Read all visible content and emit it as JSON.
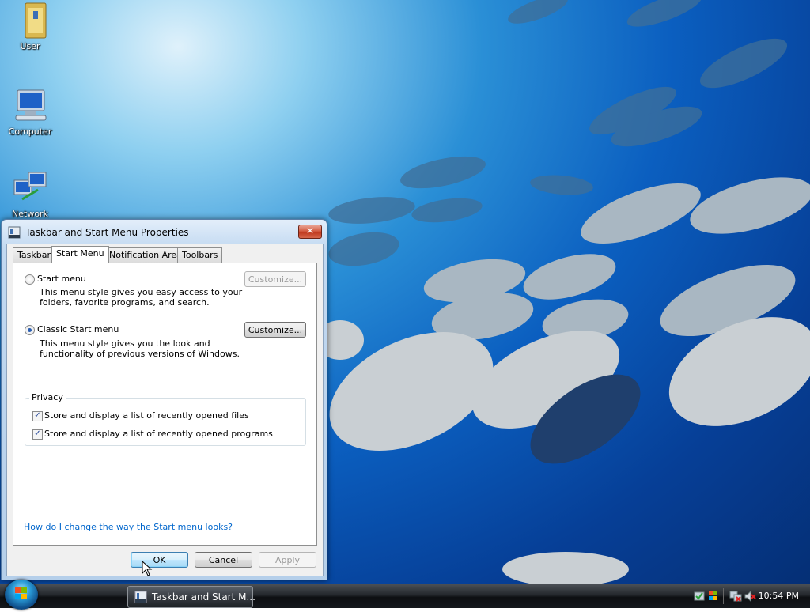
{
  "desktop": {
    "icons": [
      {
        "label": "User"
      },
      {
        "label": "Computer"
      },
      {
        "label": "Network"
      }
    ]
  },
  "dialog": {
    "title": "Taskbar and Start Menu Properties",
    "close_glyph": "✕",
    "tabs": [
      "Taskbar",
      "Start Menu",
      "Notification Area",
      "Toolbars"
    ],
    "active_tab": "Start Menu",
    "start_menu": {
      "label": "Start menu",
      "desc_line1": "This menu style gives you easy access to your",
      "desc_line2": "folders, favorite programs, and search.",
      "customize": "Customize...",
      "selected": false,
      "customize_enabled": false
    },
    "classic_menu": {
      "label": "Classic Start menu",
      "desc_line1": "This menu style gives you the look and",
      "desc_line2": "functionality of previous versions of Windows.",
      "customize": "Customize...",
      "selected": true,
      "customize_enabled": true
    },
    "privacy": {
      "legend": "Privacy",
      "files_label": "Store and display a list of recently opened files",
      "programs_label": "Store and display a list of recently opened programs",
      "files_checked": true,
      "programs_checked": true,
      "check_glyph": "✓"
    },
    "help_link": "How do I change the way the Start menu looks?",
    "buttons": {
      "ok": "OK",
      "cancel": "Cancel",
      "apply": "Apply"
    }
  },
  "taskbar": {
    "task_label": "Taskbar and Start M...",
    "clock": "10:54 PM"
  },
  "colors": {
    "link": "#0066cc",
    "close_red": "#c0391e",
    "radio_dot": "#2b5fb2"
  }
}
